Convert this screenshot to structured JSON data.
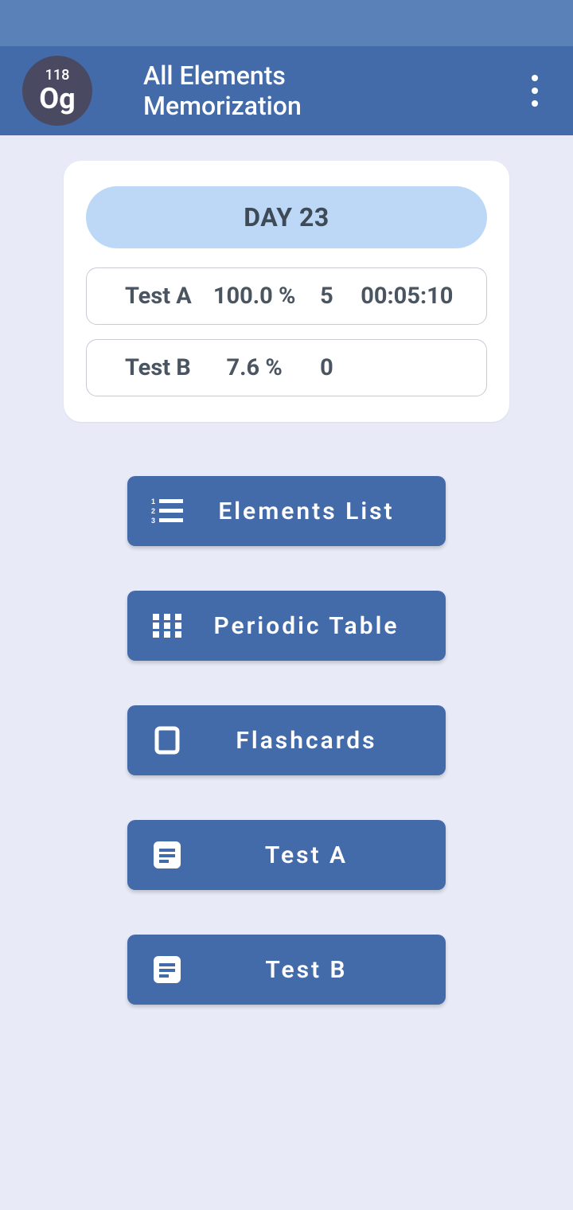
{
  "header": {
    "logo_number": "118",
    "logo_symbol": "Og",
    "title": "All Elements Memorization"
  },
  "summary": {
    "day_label": "DAY 23",
    "rows": [
      {
        "name": "Test A",
        "percent": "100.0 %",
        "count": "5",
        "time": "00:05:10"
      },
      {
        "name": "Test B",
        "percent": "7.6 %",
        "count": "0",
        "time": ""
      }
    ]
  },
  "buttons": {
    "elements_list": "Elements List",
    "periodic_table": "Periodic Table",
    "flashcards": "Flashcards",
    "test_a": "Test A",
    "test_b": "Test B"
  }
}
